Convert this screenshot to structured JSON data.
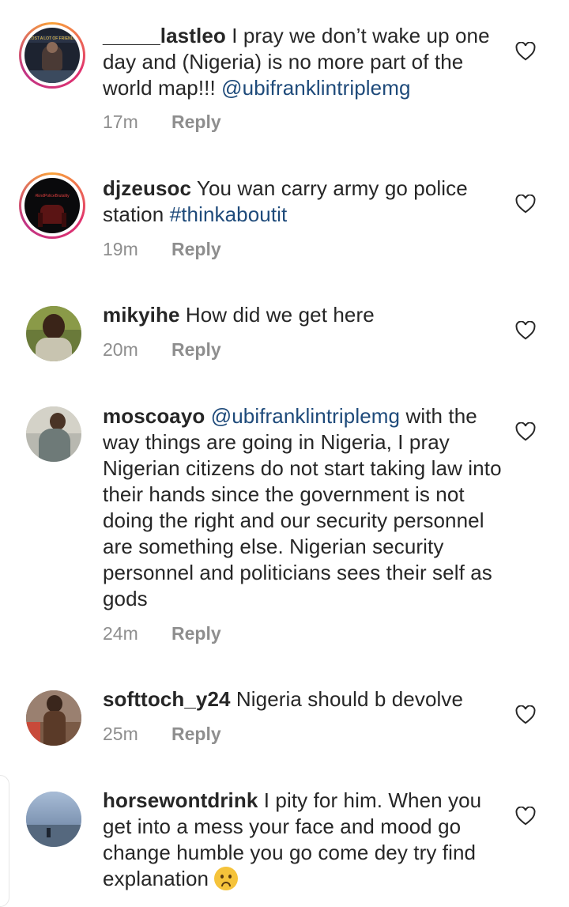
{
  "comments": [
    {
      "username": "_____lastleo",
      "text": " I pray we don’t wake up one day and (Nigeria) is no more part of the world map!!! ",
      "mention": "@ubifranklintriplemg",
      "time": "17m",
      "reply": "Reply",
      "avatar_caption": "I LOST A LOT OF FRIENDS WH..."
    },
    {
      "username": "djzeusoc",
      "text": " You wan carry army go police station ",
      "hashtag": "#thinkaboutit",
      "time": "19m",
      "reply": "Reply",
      "avatar_caption": "#EndPoliceBrutality"
    },
    {
      "username": "mikyihe",
      "text": " How did we get here",
      "time": "20m",
      "reply": "Reply"
    },
    {
      "username": "moscoayo",
      "mention": "@ubifranklintriplemg",
      "text": " with the way things are going in Nigeria, I pray Nigerian citizens do not start taking law into their hands since the government is not doing the right and our security personnel are something else. Nigerian security personnel and politicians sees their self as gods",
      "time": "24m",
      "reply": "Reply"
    },
    {
      "username": "softtoch_y24",
      "text": " Nigeria should b devolve",
      "time": "25m",
      "reply": "Reply"
    },
    {
      "username": "horsewontdrink",
      "text": " I pity for him. When you get into a mess your face and mood go change humble you go come dey try find explanation ",
      "emoji": "worried-face"
    }
  ],
  "icons": {
    "like": "heart-outline-icon"
  },
  "colors": {
    "text": "#262626",
    "meta": "#8e8e8e",
    "link": "#1e4a7a",
    "story_ring": [
      "#f9a33a",
      "#e0306e",
      "#c13584"
    ]
  }
}
